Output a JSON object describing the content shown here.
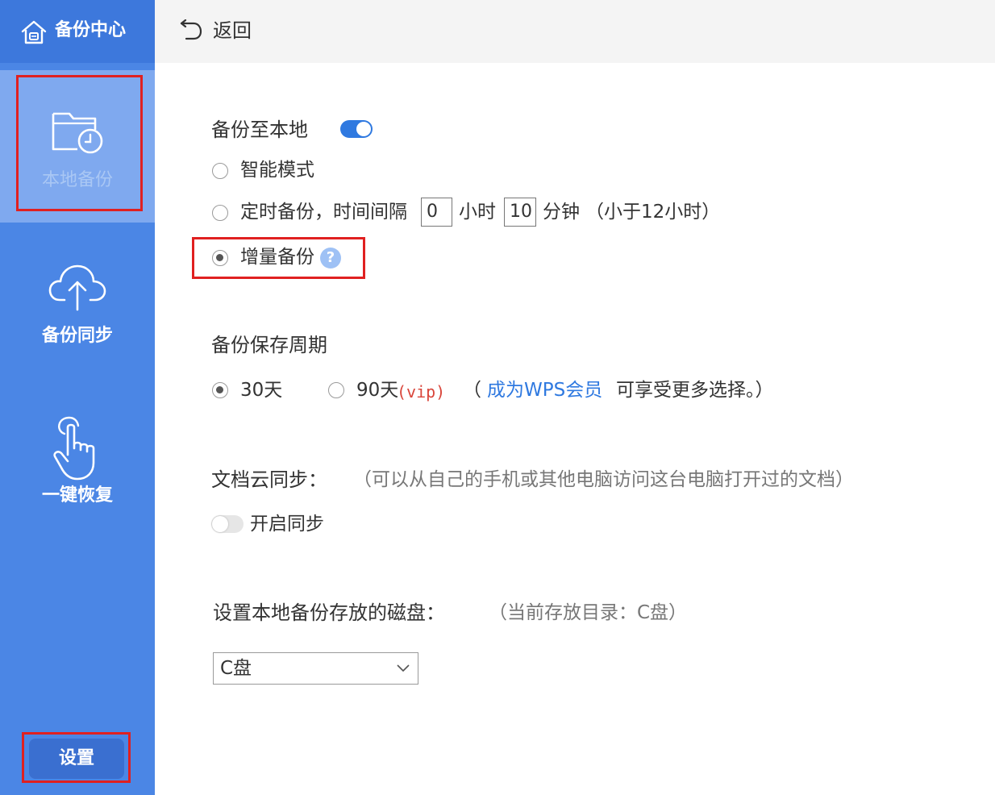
{
  "sidebar": {
    "title": "备份中心",
    "items": [
      {
        "label": "本地备份",
        "icon": "folder-clock-icon"
      },
      {
        "label": "备份同步",
        "icon": "cloud-upload-icon"
      },
      {
        "label": "一键恢复",
        "icon": "hand-pointer-icon"
      }
    ],
    "settings_label": "设置"
  },
  "topbar": {
    "back_label": "返回"
  },
  "local_backup": {
    "title": "备份至本地",
    "enabled": true,
    "smart_mode": "智能模式",
    "timed_prefix": "定时备份，时间间隔",
    "hours_value": "0",
    "hours_unit": "小时",
    "minutes_value": "10",
    "minutes_unit": "分钟",
    "limit_note": "（小于12小时）",
    "incremental": "增量备份",
    "help": "?"
  },
  "retention": {
    "title": "备份保存周期",
    "opt30": "30天",
    "opt90": "90天",
    "vip": "(vip)",
    "note_open": "（",
    "vip_link": "成为WPS会员",
    "note_rest": "可享受更多选择。）"
  },
  "cloud_sync": {
    "title": "文档云同步：",
    "desc": "（可以从自己的手机或其他电脑访问这台电脑打开过的文档）",
    "toggle_label": "开启同步",
    "enabled": false
  },
  "disk": {
    "title": "设置本地备份存放的磁盘：",
    "current": "（当前存放目录：C盘）",
    "selected": "C盘"
  },
  "colors": {
    "sidebar": "#4b86e5",
    "accent": "#2f79e0",
    "highlight_box": "#e02020"
  }
}
